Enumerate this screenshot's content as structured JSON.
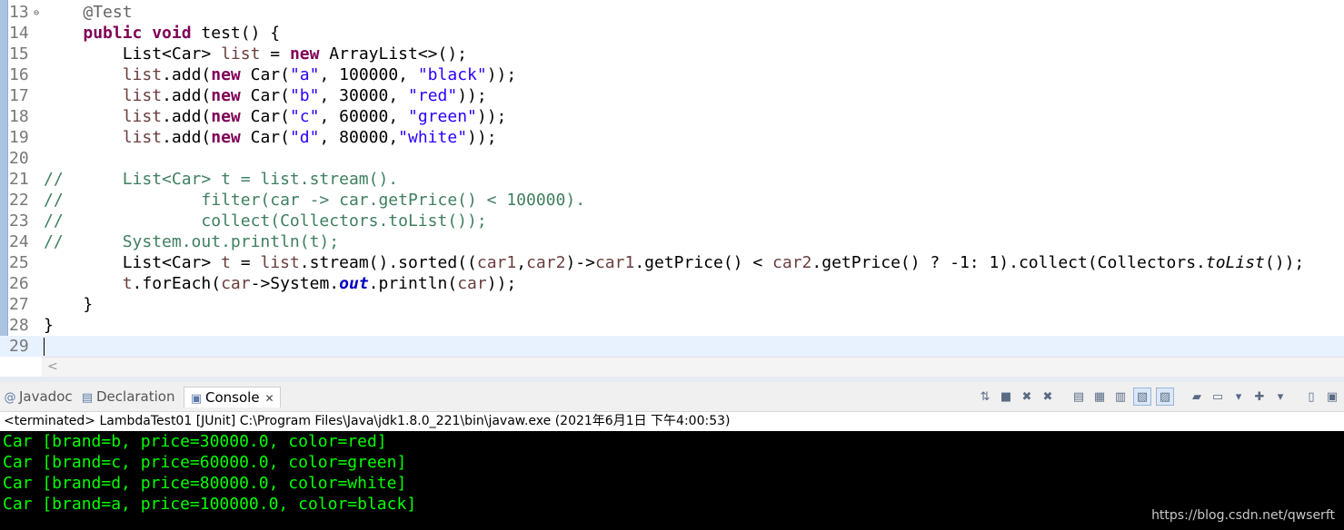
{
  "editor": {
    "lines": [
      {
        "num": "13",
        "fold": "⊖",
        "tokens": [
          {
            "t": "    ",
            "c": "txt"
          },
          {
            "t": "@Test",
            "c": "ann"
          }
        ]
      },
      {
        "num": "14",
        "tokens": [
          {
            "t": "    ",
            "c": "txt"
          },
          {
            "t": "public void",
            "c": "kw"
          },
          {
            "t": " test() {",
            "c": "txt"
          }
        ]
      },
      {
        "num": "15",
        "tokens": [
          {
            "t": "        List<Car> ",
            "c": "txt"
          },
          {
            "t": "list",
            "c": "var"
          },
          {
            "t": " = ",
            "c": "txt"
          },
          {
            "t": "new",
            "c": "kw"
          },
          {
            "t": " ArrayList<>();",
            "c": "txt"
          }
        ]
      },
      {
        "num": "16",
        "tokens": [
          {
            "t": "        ",
            "c": "txt"
          },
          {
            "t": "list",
            "c": "var"
          },
          {
            "t": ".add(",
            "c": "txt"
          },
          {
            "t": "new",
            "c": "kw"
          },
          {
            "t": " Car(",
            "c": "txt"
          },
          {
            "t": "\"a\"",
            "c": "str"
          },
          {
            "t": ", 100000, ",
            "c": "txt"
          },
          {
            "t": "\"black\"",
            "c": "str"
          },
          {
            "t": "));",
            "c": "txt"
          }
        ]
      },
      {
        "num": "17",
        "tokens": [
          {
            "t": "        ",
            "c": "txt"
          },
          {
            "t": "list",
            "c": "var"
          },
          {
            "t": ".add(",
            "c": "txt"
          },
          {
            "t": "new",
            "c": "kw"
          },
          {
            "t": " Car(",
            "c": "txt"
          },
          {
            "t": "\"b\"",
            "c": "str"
          },
          {
            "t": ", 30000, ",
            "c": "txt"
          },
          {
            "t": "\"red\"",
            "c": "str"
          },
          {
            "t": "));",
            "c": "txt"
          }
        ]
      },
      {
        "num": "18",
        "tokens": [
          {
            "t": "        ",
            "c": "txt"
          },
          {
            "t": "list",
            "c": "var"
          },
          {
            "t": ".add(",
            "c": "txt"
          },
          {
            "t": "new",
            "c": "kw"
          },
          {
            "t": " Car(",
            "c": "txt"
          },
          {
            "t": "\"c\"",
            "c": "str"
          },
          {
            "t": ", 60000, ",
            "c": "txt"
          },
          {
            "t": "\"green\"",
            "c": "str"
          },
          {
            "t": "));",
            "c": "txt"
          }
        ]
      },
      {
        "num": "19",
        "tokens": [
          {
            "t": "        ",
            "c": "txt"
          },
          {
            "t": "list",
            "c": "var"
          },
          {
            "t": ".add(",
            "c": "txt"
          },
          {
            "t": "new",
            "c": "kw"
          },
          {
            "t": " Car(",
            "c": "txt"
          },
          {
            "t": "\"d\"",
            "c": "str"
          },
          {
            "t": ", 80000,",
            "c": "txt"
          },
          {
            "t": "\"white\"",
            "c": "str"
          },
          {
            "t": "));",
            "c": "txt"
          }
        ]
      },
      {
        "num": "20",
        "tokens": []
      },
      {
        "num": "21",
        "tokens": [
          {
            "t": "//      List<Car> t = list.stream().",
            "c": "cmt"
          }
        ]
      },
      {
        "num": "22",
        "tokens": [
          {
            "t": "//              filter(car -> car.getPrice() < 100000).",
            "c": "cmt"
          }
        ]
      },
      {
        "num": "23",
        "tokens": [
          {
            "t": "//              collect(Collectors.toList());",
            "c": "cmt"
          }
        ]
      },
      {
        "num": "24",
        "tokens": [
          {
            "t": "//      System.out.println(t);",
            "c": "cmt"
          }
        ]
      },
      {
        "num": "25",
        "tokens": [
          {
            "t": "        List<Car> ",
            "c": "txt"
          },
          {
            "t": "t",
            "c": "var"
          },
          {
            "t": " = ",
            "c": "txt"
          },
          {
            "t": "list",
            "c": "var"
          },
          {
            "t": ".stream().sorted((",
            "c": "txt"
          },
          {
            "t": "car1",
            "c": "var"
          },
          {
            "t": ",",
            "c": "txt"
          },
          {
            "t": "car2",
            "c": "var"
          },
          {
            "t": ")->",
            "c": "txt"
          },
          {
            "t": "car1",
            "c": "var"
          },
          {
            "t": ".getPrice() < ",
            "c": "txt"
          },
          {
            "t": "car2",
            "c": "var"
          },
          {
            "t": ".getPrice() ? -1: 1).collect(Collectors.",
            "c": "txt"
          },
          {
            "t": "toList",
            "c": "it"
          },
          {
            "t": "());",
            "c": "txt"
          }
        ]
      },
      {
        "num": "26",
        "tokens": [
          {
            "t": "        ",
            "c": "txt"
          },
          {
            "t": "t",
            "c": "var"
          },
          {
            "t": ".forEach(",
            "c": "txt"
          },
          {
            "t": "car",
            "c": "var"
          },
          {
            "t": "->System.",
            "c": "txt"
          },
          {
            "t": "out",
            "c": "st"
          },
          {
            "t": ".println(",
            "c": "txt"
          },
          {
            "t": "car",
            "c": "var"
          },
          {
            "t": "));",
            "c": "txt"
          }
        ]
      },
      {
        "num": "27",
        "tokens": [
          {
            "t": "    }",
            "c": "txt"
          }
        ]
      },
      {
        "num": "28",
        "tokens": [
          {
            "t": "}",
            "c": "txt"
          }
        ]
      },
      {
        "num": "29",
        "tokens": [],
        "current": true
      }
    ],
    "hscroll_arrow": "<"
  },
  "tabs": [
    {
      "label": "Javadoc",
      "icon": "@",
      "name": "tab-javadoc"
    },
    {
      "label": "Declaration",
      "icon": "▤",
      "name": "tab-declaration"
    },
    {
      "label": "Console",
      "icon": "▣",
      "name": "tab-console",
      "active": true,
      "close": "✕"
    }
  ],
  "toolbar": [
    {
      "icon": "⇅",
      "name": "pin-console-icon"
    },
    {
      "icon": "■",
      "name": "terminate-icon"
    },
    {
      "icon": "✖",
      "name": "remove-launch-icon"
    },
    {
      "icon": "✖",
      "name": "remove-all-terminated-icon"
    },
    {
      "sep": true
    },
    {
      "icon": "▤",
      "name": "scroll-lock-icon"
    },
    {
      "icon": "▦",
      "name": "word-wrap-icon"
    },
    {
      "icon": "▥",
      "name": "clear-console-icon"
    },
    {
      "icon": "▧",
      "name": "show-on-stdout-icon",
      "pressed": true
    },
    {
      "icon": "▨",
      "name": "show-on-stderr-icon",
      "pressed": true
    },
    {
      "sep": true
    },
    {
      "icon": "▰",
      "name": "pin-icon"
    },
    {
      "icon": "▭",
      "name": "display-console-icon"
    },
    {
      "icon": "▾",
      "name": "display-console-menu-icon"
    },
    {
      "icon": "✚",
      "name": "open-console-icon"
    },
    {
      "icon": "▾",
      "name": "open-console-menu-icon"
    },
    {
      "sep": true
    },
    {
      "icon": "▯",
      "name": "minimize-icon"
    },
    {
      "icon": "▣",
      "name": "maximize-icon"
    }
  ],
  "console": {
    "status": "<terminated> LambdaTest01 [JUnit] C:\\Program Files\\Java\\jdk1.8.0_221\\bin\\javaw.exe (2021年6月1日 下午4:00:53)",
    "output": [
      "Car [brand=b, price=30000.0, color=red]",
      "Car [brand=c, price=60000.0, color=green]",
      "Car [brand=d, price=80000.0, color=white]",
      "Car [brand=a, price=100000.0, color=black]"
    ],
    "watermark": "https://blog.csdn.net/qwserft"
  },
  "colors": {
    "keyword": "#7f0055",
    "string": "#2a00ff",
    "comment": "#3f7f5f",
    "local_variable": "#6a3e3e",
    "console_text": "#00ff00",
    "console_bg": "#000000"
  }
}
